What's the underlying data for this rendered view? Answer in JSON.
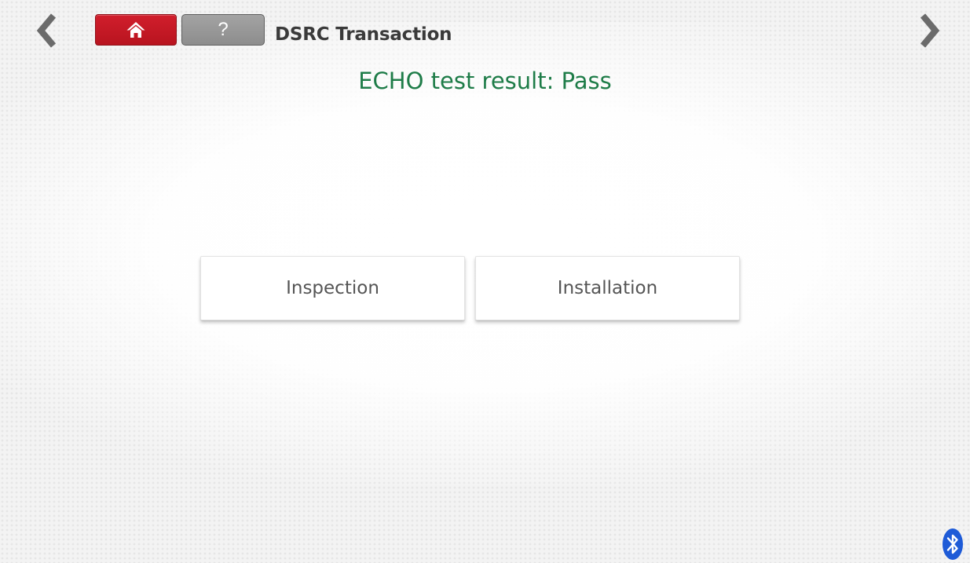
{
  "header": {
    "title": "DSRC Transaction",
    "prev_icon": "chevron-left-icon",
    "next_icon": "chevron-right-icon",
    "home_icon": "home-icon",
    "help_label": "?",
    "home_color": "#c8191f",
    "help_color": "#999999"
  },
  "main": {
    "status_message": "ECHO test result: Pass",
    "status_color": "#1e7c48",
    "options": [
      {
        "label": "Inspection"
      },
      {
        "label": "Installation"
      }
    ]
  },
  "footer": {
    "bluetooth_icon": "bluetooth-icon",
    "bluetooth_color": "#1e5bd7"
  }
}
